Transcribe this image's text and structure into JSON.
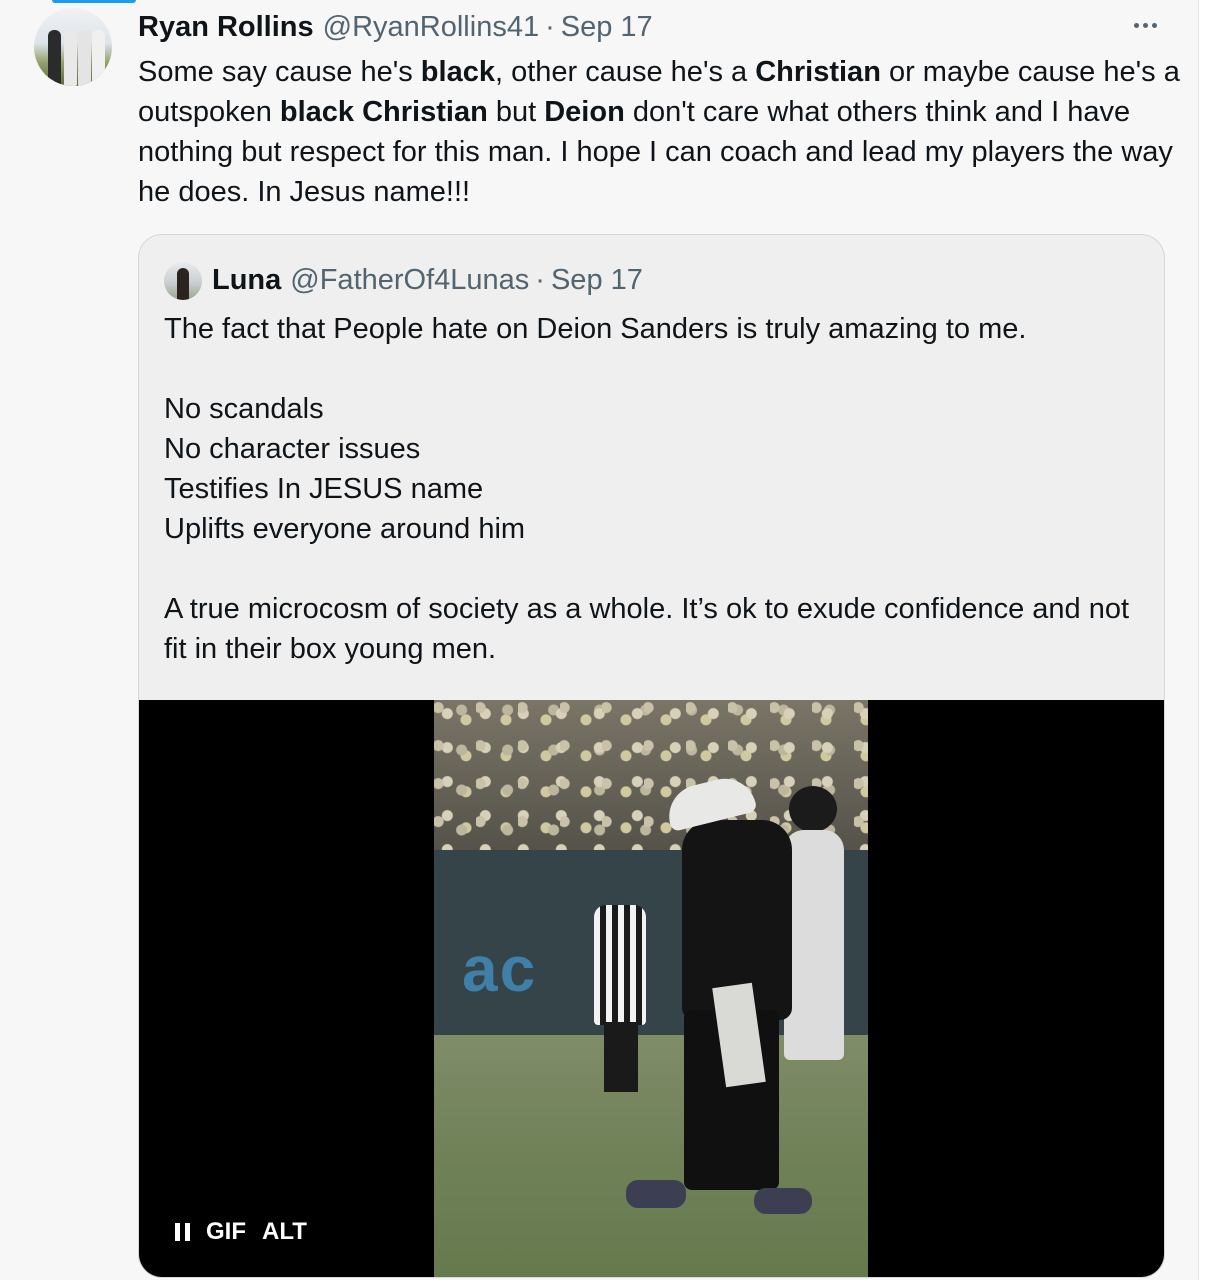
{
  "tweet": {
    "author_name": "Ryan Rollins",
    "author_handle": "@RyanRollins41",
    "separator": "·",
    "date": "Sep 17",
    "text_parts": [
      {
        "text": "Some say cause he's ",
        "bold": false
      },
      {
        "text": "black",
        "bold": true
      },
      {
        "text": ", other cause he's a ",
        "bold": false
      },
      {
        "text": "Christian",
        "bold": true
      },
      {
        "text": " or maybe cause he's a outspoken ",
        "bold": false
      },
      {
        "text": "black Christian",
        "bold": true
      },
      {
        "text": " but ",
        "bold": false
      },
      {
        "text": "Deion",
        "bold": true
      },
      {
        "text": " don't care what others think and I have nothing but respect for this man. I hope I can coach and lead my players the way he does. In Jesus name!!!",
        "bold": false
      }
    ]
  },
  "quote": {
    "author_name": "Luna",
    "author_handle": "@FatherOf4Lunas",
    "separator": "·",
    "date": "Sep 17",
    "lines": [
      "The fact that People hate on Deion Sanders is truly amazing to me.",
      "",
      "No scandals",
      "No character issues",
      "Testifies In JESUS name",
      "Uplifts everyone around him",
      "",
      "A true microcosm of society as a whole.  It’s ok to exude confidence and not fit in their box young men."
    ],
    "media": {
      "gif_label": "GIF",
      "alt_label": "ALT",
      "wall_text": "ac"
    }
  },
  "icons": {
    "more": "more-horizontal-icon",
    "pause": "pause-icon"
  },
  "colors": {
    "accent": "#1d9bf0",
    "secondary_text": "#536471",
    "border": "#cfd9de"
  }
}
